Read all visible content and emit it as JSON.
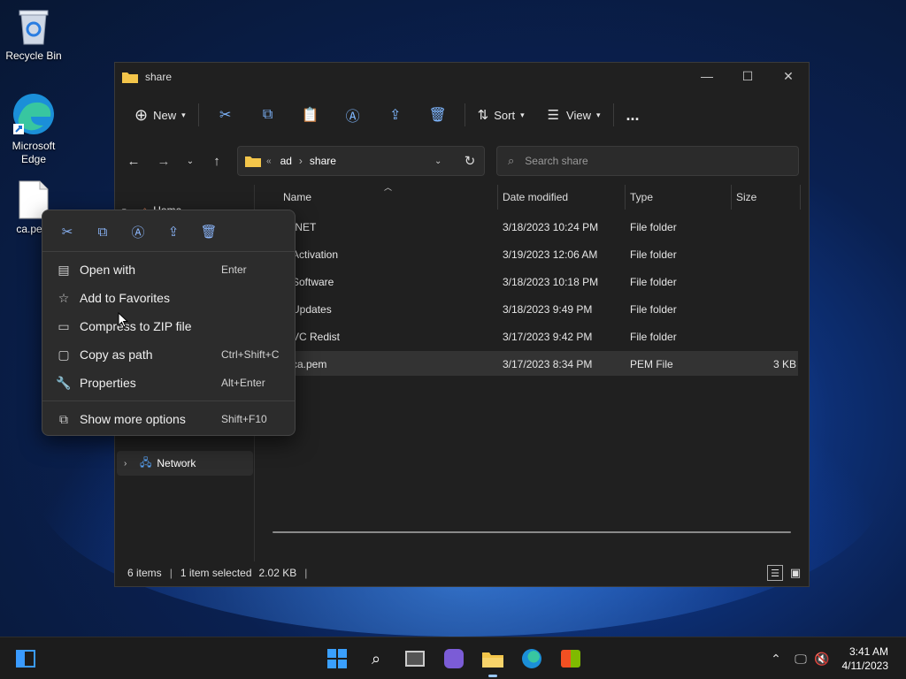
{
  "desktop": {
    "icons": [
      {
        "label": "Recycle Bin",
        "icon": "recycle-bin-icon"
      },
      {
        "label": "Microsoft Edge",
        "icon": "edge-icon"
      },
      {
        "label": "ca.pem",
        "icon": "file-icon"
      }
    ]
  },
  "window": {
    "title": "share",
    "toolbar": {
      "new_label": "New",
      "sort_label": "Sort",
      "view_label": "View",
      "more": "..."
    },
    "address": {
      "prefix": "«",
      "segment1": "ad",
      "separator": "›",
      "segment2": "share"
    },
    "search": {
      "placeholder": "Search share"
    },
    "nav": {
      "home_label": "Home",
      "network_label": "Network"
    },
    "columns": {
      "name": "Name",
      "date": "Date modified",
      "type": "Type",
      "size": "Size"
    },
    "rows": [
      {
        "name": ".NET",
        "date": "3/18/2023 10:24 PM",
        "type": "File folder",
        "size": ""
      },
      {
        "name": "Activation",
        "date": "3/19/2023 12:06 AM",
        "type": "File folder",
        "size": ""
      },
      {
        "name": "Software",
        "date": "3/18/2023 10:18 PM",
        "type": "File folder",
        "size": ""
      },
      {
        "name": "Updates",
        "date": "3/18/2023 9:49 PM",
        "type": "File folder",
        "size": ""
      },
      {
        "name": "VC Redist",
        "date": "3/17/2023 9:42 PM",
        "type": "File folder",
        "size": ""
      },
      {
        "name": "ca.pem",
        "date": "3/17/2023 8:34 PM",
        "type": "PEM File",
        "size": "3 KB"
      }
    ],
    "status": {
      "items": "6 items",
      "selected": "1 item selected",
      "size": "2.02 KB",
      "pipe": "|"
    }
  },
  "context_menu": {
    "items": [
      {
        "label": "Open with",
        "shortcut": "Enter",
        "icon": "open-with-icon"
      },
      {
        "label": "Add to Favorites",
        "shortcut": "",
        "icon": "star-icon"
      },
      {
        "label": "Compress to ZIP file",
        "shortcut": "",
        "icon": "zip-icon"
      },
      {
        "label": "Copy as path",
        "shortcut": "Ctrl+Shift+C",
        "icon": "copy-path-icon"
      },
      {
        "label": "Properties",
        "shortcut": "Alt+Enter",
        "icon": "properties-icon"
      },
      {
        "label": "Show more options",
        "shortcut": "Shift+F10",
        "icon": "more-options-icon"
      }
    ]
  },
  "taskbar": {
    "time": "3:41 AM",
    "date": "4/11/2023"
  },
  "colors": {
    "accent": "#7fb7ff",
    "window_bg": "#202020",
    "menu_bg": "#2c2c2c",
    "taskbar_bg": "#1c1c1c",
    "folder": "#f3c54a"
  }
}
